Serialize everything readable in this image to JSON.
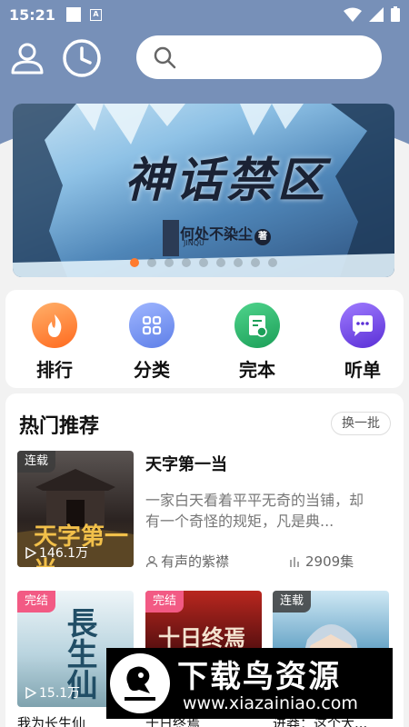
{
  "status_bar": {
    "time": "15:21",
    "a_icon": "A"
  },
  "header": {
    "search_placeholder": ""
  },
  "banner": {
    "title": "神话禁区",
    "author": "何处不染尘",
    "author_mark": "著",
    "subtitle": "JINQU",
    "page_count": 9,
    "active_index": 0
  },
  "quick_nav": [
    {
      "label": "排行",
      "icon": "fire-icon",
      "color": "#ff7a2a"
    },
    {
      "label": "分类",
      "icon": "grid-icon",
      "color": "#6f8ef0"
    },
    {
      "label": "完本",
      "icon": "book-check-icon",
      "color": "#27b46b"
    },
    {
      "label": "听单",
      "icon": "chat-bubble-icon",
      "color": "#7a4fe6"
    }
  ],
  "hot": {
    "title": "热门推荐",
    "swap_label": "换一批",
    "featured": {
      "tag": "连载",
      "play_count": "146.1万",
      "name": "天字第一当",
      "description": "一家白天看着平平无奇的当铺，却有一个奇怪的规矩，凡是典...",
      "narrator": "有声的紫襟",
      "episodes": "2909集"
    },
    "books": [
      {
        "tag": "完结",
        "play_count": "15.1万",
        "title": "我为长生仙"
      },
      {
        "tag": "完结",
        "play_count": "",
        "title": "十日终焉"
      },
      {
        "tag": "连载",
        "play_count": "",
        "title": "进莽：这个大..."
      }
    ]
  },
  "watermark": {
    "title": "下载鸟资源",
    "url": "www.xiazainiao.com"
  }
}
